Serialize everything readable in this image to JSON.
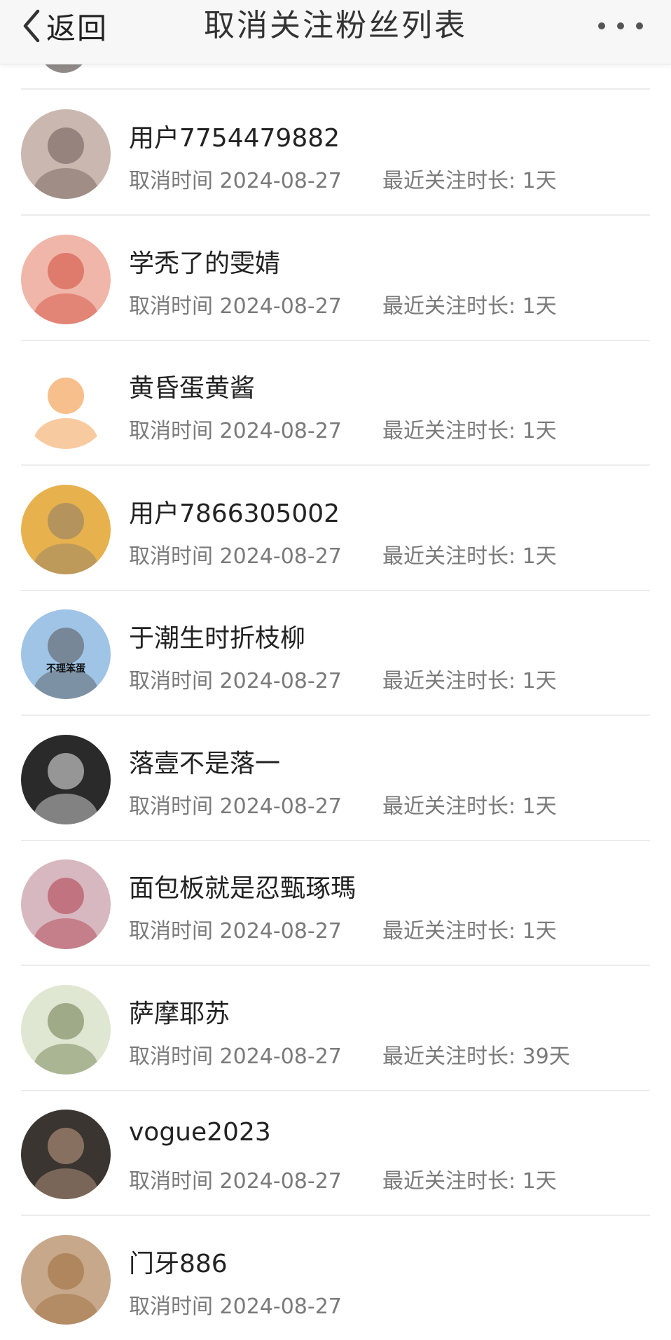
{
  "header": {
    "back_label": "返回",
    "title": "取消关注粉丝列表"
  },
  "rows": [
    {
      "name": "用户7754479882",
      "cancel": "取消时间 2024-08-27",
      "duration": "最近关注时长: 1天",
      "avatar_color": "#c9b7b0",
      "avatar_accent": "#6d5a55"
    },
    {
      "name": "学秃了的雯婧",
      "cancel": "取消时间 2024-08-27",
      "duration": "最近关注时长: 1天",
      "avatar_color": "#f0b6a9",
      "avatar_accent": "#d14a3a"
    },
    {
      "name": "黄昏蛋黄酱",
      "cancel": "取消时间 2024-08-27",
      "duration": "最近关注时长: 1天",
      "avatar_color": "#ffffff",
      "avatar_accent": "#f08a2b"
    },
    {
      "name": "用户7866305002",
      "cancel": "取消时间 2024-08-27",
      "duration": "最近关注时长: 1天",
      "avatar_color": "#e7b24e",
      "avatar_accent": "#8a7a6a"
    },
    {
      "name": "于潮生时折枝柳",
      "cancel": "取消时间 2024-08-27",
      "duration": "最近关注时长: 1天",
      "avatar_color": "#9fc4e6",
      "avatar_accent": "#555555",
      "avatar_text": "不理笨蛋"
    },
    {
      "name": "落壹不是落一",
      "cancel": "取消时间 2024-08-27",
      "duration": "最近关注时长: 1天",
      "avatar_color": "#2a2a2a",
      "avatar_accent": "#eeeeee"
    },
    {
      "name": "面包板就是忍甄琢瑪",
      "cancel": "取消时间 2024-08-27",
      "duration": "最近关注时长: 1天",
      "avatar_color": "#d8b8c0",
      "avatar_accent": "#b03a4a"
    },
    {
      "name": "萨摩耶苏",
      "cancel": "取消时间 2024-08-27",
      "duration": "最近关注时长: 39天",
      "avatar_color": "#dfe6d2",
      "avatar_accent": "#6a7a4a"
    },
    {
      "name": "vogue2023",
      "cancel": "取消时间 2024-08-27",
      "duration": "最近关注时长: 1天",
      "avatar_color": "#3a3530",
      "avatar_accent": "#c9a18a"
    },
    {
      "name": "门牙886",
      "cancel": "取消时间 2024-08-27",
      "duration": "",
      "avatar_color": "#c8a88a",
      "avatar_accent": "#9a6a3a"
    }
  ]
}
